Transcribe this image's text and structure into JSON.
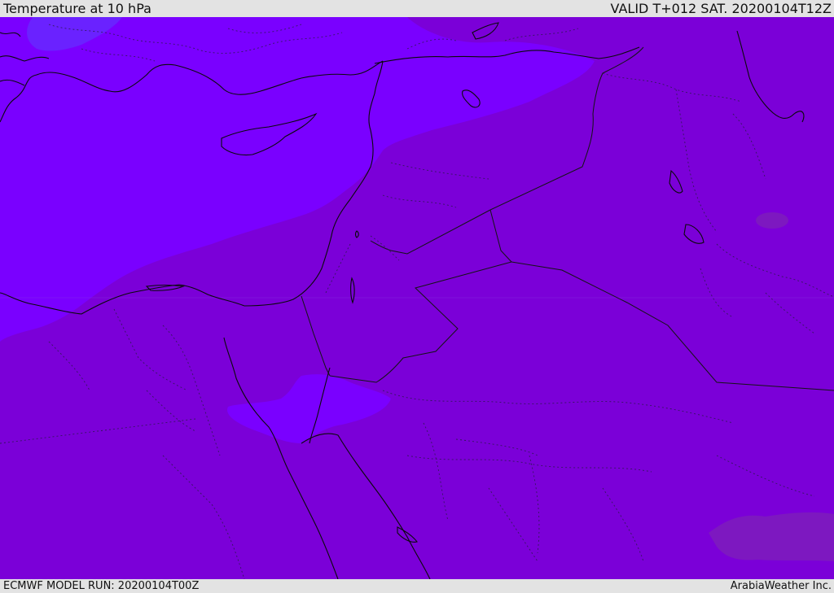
{
  "header": {
    "title": "Temperature at 10 hPa",
    "valid_time": "VALID T+012 SAT. 20200104T12Z"
  },
  "footer": {
    "model_run": "ECMWF MODEL RUN: 20200104T00Z",
    "credit": "ArabiaWeather Inc."
  },
  "colors": {
    "background_bar": "#e3e3e3",
    "field_main": "#7b00d8",
    "field_warm": "#7a00ff",
    "field_cold_patch": "#6a22ff",
    "field_brown_patch": "#7d18c0"
  }
}
